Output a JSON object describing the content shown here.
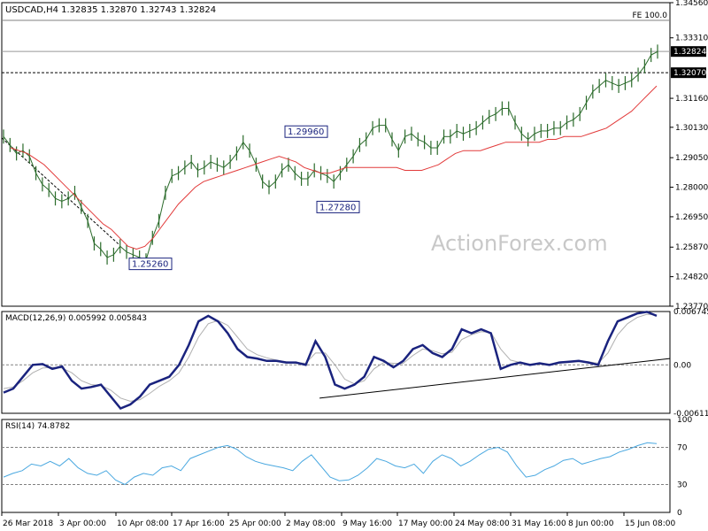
{
  "chart_data": [
    {
      "type": "line",
      "title": "USDCAD,H4",
      "ohlc_label": "1.32835 1.32870 1.32743 1.32824",
      "watermark": "ActionForex.com",
      "fe_label": "FE 100.0",
      "y_ticks": [
        "1.34560",
        "1.33310",
        "1.32824",
        "1.32070",
        "1.31160",
        "1.30130",
        "1.29050",
        "1.28000",
        "1.26950",
        "1.25870",
        "1.24820",
        "1.23770"
      ],
      "ylim": [
        1.2377,
        1.3456
      ],
      "current_price": "1.32824",
      "level_line": "1.32070",
      "fe_level": 1.3456,
      "annotations": [
        {
          "label": "1.29960",
          "value": 1.2996
        },
        {
          "label": "1.27280",
          "value": 1.2728
        },
        {
          "label": "1.25260",
          "value": 1.2526
        }
      ],
      "series": [
        {
          "values": [
            1.298,
            1.295,
            1.292,
            1.293,
            1.291,
            1.285,
            1.281,
            1.279,
            1.276,
            1.275,
            1.276,
            1.278,
            1.273,
            1.268,
            1.26,
            1.258,
            1.255,
            1.256,
            1.259,
            1.257,
            1.256,
            1.255,
            1.254,
            1.262,
            1.268,
            1.278,
            1.284,
            1.285,
            1.287,
            1.289,
            1.286,
            1.287,
            1.289,
            1.288,
            1.287,
            1.289,
            1.292,
            1.296,
            1.293,
            1.288,
            1.282,
            1.28,
            1.282,
            1.286,
            1.288,
            1.285,
            1.283,
            1.283,
            1.286,
            1.285,
            1.284,
            1.282,
            1.285,
            1.288,
            1.291,
            1.295,
            1.297,
            1.301,
            1.302,
            1.302,
            1.297,
            1.293,
            1.298,
            1.299,
            1.297,
            1.296,
            1.294,
            1.294,
            1.298,
            1.298,
            1.3,
            1.299,
            1.3,
            1.301,
            1.303,
            1.305,
            1.306,
            1.308,
            1.308,
            1.303,
            1.299,
            1.297,
            1.299,
            1.3,
            1.3,
            1.301,
            1.301,
            1.303,
            1.304,
            1.306,
            1.31,
            1.314,
            1.316,
            1.318,
            1.317,
            1.316,
            1.317,
            1.318,
            1.32,
            1.323,
            1.327,
            1.3282
          ]
        },
        {
          "values": [
            1.294,
            1.293,
            1.292,
            1.29,
            1.288,
            1.285,
            1.282,
            1.279,
            1.276,
            1.273,
            1.27,
            1.267,
            1.265,
            1.262,
            1.259,
            1.258,
            1.259,
            1.262,
            1.266,
            1.27,
            1.274,
            1.277,
            1.28,
            1.282,
            1.283,
            1.284,
            1.285,
            1.286,
            1.287,
            1.288,
            1.289,
            1.29,
            1.291,
            1.29,
            1.289,
            1.287,
            1.286,
            1.285,
            1.285,
            1.286,
            1.287,
            1.287,
            1.287,
            1.287,
            1.287,
            1.287,
            1.287,
            1.286,
            1.286,
            1.286,
            1.287,
            1.288,
            1.29,
            1.292,
            1.293,
            1.293,
            1.293,
            1.294,
            1.295,
            1.296,
            1.296,
            1.296,
            1.296,
            1.296,
            1.297,
            1.297,
            1.298,
            1.298,
            1.298,
            1.299,
            1.3,
            1.301,
            1.303,
            1.305,
            1.307,
            1.31,
            1.313,
            1.316
          ]
        }
      ]
    },
    {
      "type": "line",
      "title": "MACD(12,26,9) 0.005992 0.005843",
      "y_ticks": [
        "0.006745",
        "0.00",
        "-0.006119"
      ],
      "ylim": [
        -0.006119,
        0.006745
      ],
      "zero_level": 0,
      "current_level": "0.006745",
      "trendline": [
        [
          0.51,
          -0.0042
        ],
        [
          1.0,
          0.0008
        ]
      ],
      "series": [
        {
          "values": [
            -0.0035,
            -0.003,
            -0.0015,
            0.0,
            0.0001,
            -0.0005,
            -0.0002,
            -0.002,
            -0.003,
            -0.0028,
            -0.0025,
            -0.004,
            -0.0055,
            -0.005,
            -0.004,
            -0.0025,
            -0.002,
            -0.0015,
            0.0,
            0.0025,
            0.0055,
            0.0062,
            0.0055,
            0.004,
            0.002,
            0.001,
            0.0008,
            0.0005,
            0.0005,
            0.0003,
            0.0003,
            0.0,
            0.003,
            0.001,
            -0.0025,
            -0.003,
            -0.0025,
            -0.0015,
            0.001,
            0.0005,
            -0.0003,
            0.0005,
            0.002,
            0.0025,
            0.0015,
            0.001,
            0.002,
            0.0045,
            0.004,
            0.0045,
            0.004,
            -0.0005,
            0.0,
            0.0003,
            0.0,
            0.0002,
            0.0,
            0.0003,
            0.0004,
            0.0005,
            0.0003,
            0.0,
            0.003,
            0.0055,
            0.006,
            0.0065,
            0.0067,
            0.0062
          ]
        },
        {
          "values": [
            -0.003,
            -0.0028,
            -0.002,
            -0.001,
            -0.0004,
            -0.0003,
            -0.0004,
            -0.001,
            -0.002,
            -0.0025,
            -0.0026,
            -0.0032,
            -0.0042,
            -0.0046,
            -0.0044,
            -0.0036,
            -0.0027,
            -0.002,
            -0.001,
            0.001,
            0.0035,
            0.0052,
            0.0056,
            0.005,
            0.0035,
            0.002,
            0.0013,
            0.0009,
            0.0006,
            0.0004,
            0.0003,
            0.0002,
            0.0015,
            0.0015,
            0.0,
            -0.0018,
            -0.0024,
            -0.002,
            -0.0005,
            0.0003,
            0.0002,
            0.0002,
            0.0012,
            0.002,
            0.0018,
            0.0014,
            0.0016,
            0.0032,
            0.0038,
            0.0042,
            0.0041,
            0.002,
            0.0006,
            0.0003,
            0.0001,
            0.0001,
            0.0001,
            0.0002,
            0.0003,
            0.0004,
            0.0004,
            0.0002,
            0.0015,
            0.0038,
            0.0052,
            0.006,
            0.0064,
            0.0063
          ]
        }
      ]
    },
    {
      "type": "line",
      "title": "RSI(14) 74.8782",
      "y_ticks": [
        "100",
        "70",
        "30",
        "0"
      ],
      "ylim": [
        0,
        100
      ],
      "levels": [
        70,
        30
      ],
      "series": [
        {
          "values": [
            38,
            42,
            45,
            52,
            50,
            55,
            50,
            58,
            48,
            42,
            40,
            45,
            35,
            30,
            38,
            42,
            40,
            48,
            50,
            45,
            58,
            62,
            66,
            70,
            72,
            68,
            60,
            55,
            52,
            50,
            48,
            45,
            55,
            62,
            50,
            38,
            34,
            35,
            40,
            48,
            58,
            55,
            50,
            48,
            52,
            42,
            55,
            62,
            58,
            50,
            55,
            62,
            68,
            70,
            65,
            50,
            38,
            40,
            46,
            50,
            56,
            58,
            52,
            55,
            58,
            60,
            65,
            68,
            72,
            75,
            74
          ]
        }
      ]
    }
  ],
  "x_axis_labels": [
    "26 Mar 2018",
    "3 Apr 00:00",
    "10 Apr 08:00",
    "17 Apr 16:00",
    "25 Apr 00:00",
    "2 May 08:00",
    "9 May 16:00",
    "17 May 00:00",
    "24 May 08:00",
    "31 May 16:00",
    "8 Jun 00:00",
    "15 Jun 08:00"
  ],
  "colors": {
    "price": "#2b6b2b",
    "ma": "#e23a3a",
    "macd": "#1a237e",
    "signal": "#b0b0b0",
    "rsi": "#4aa8e0",
    "label_border": "#1a237e",
    "grid": "#808080"
  }
}
